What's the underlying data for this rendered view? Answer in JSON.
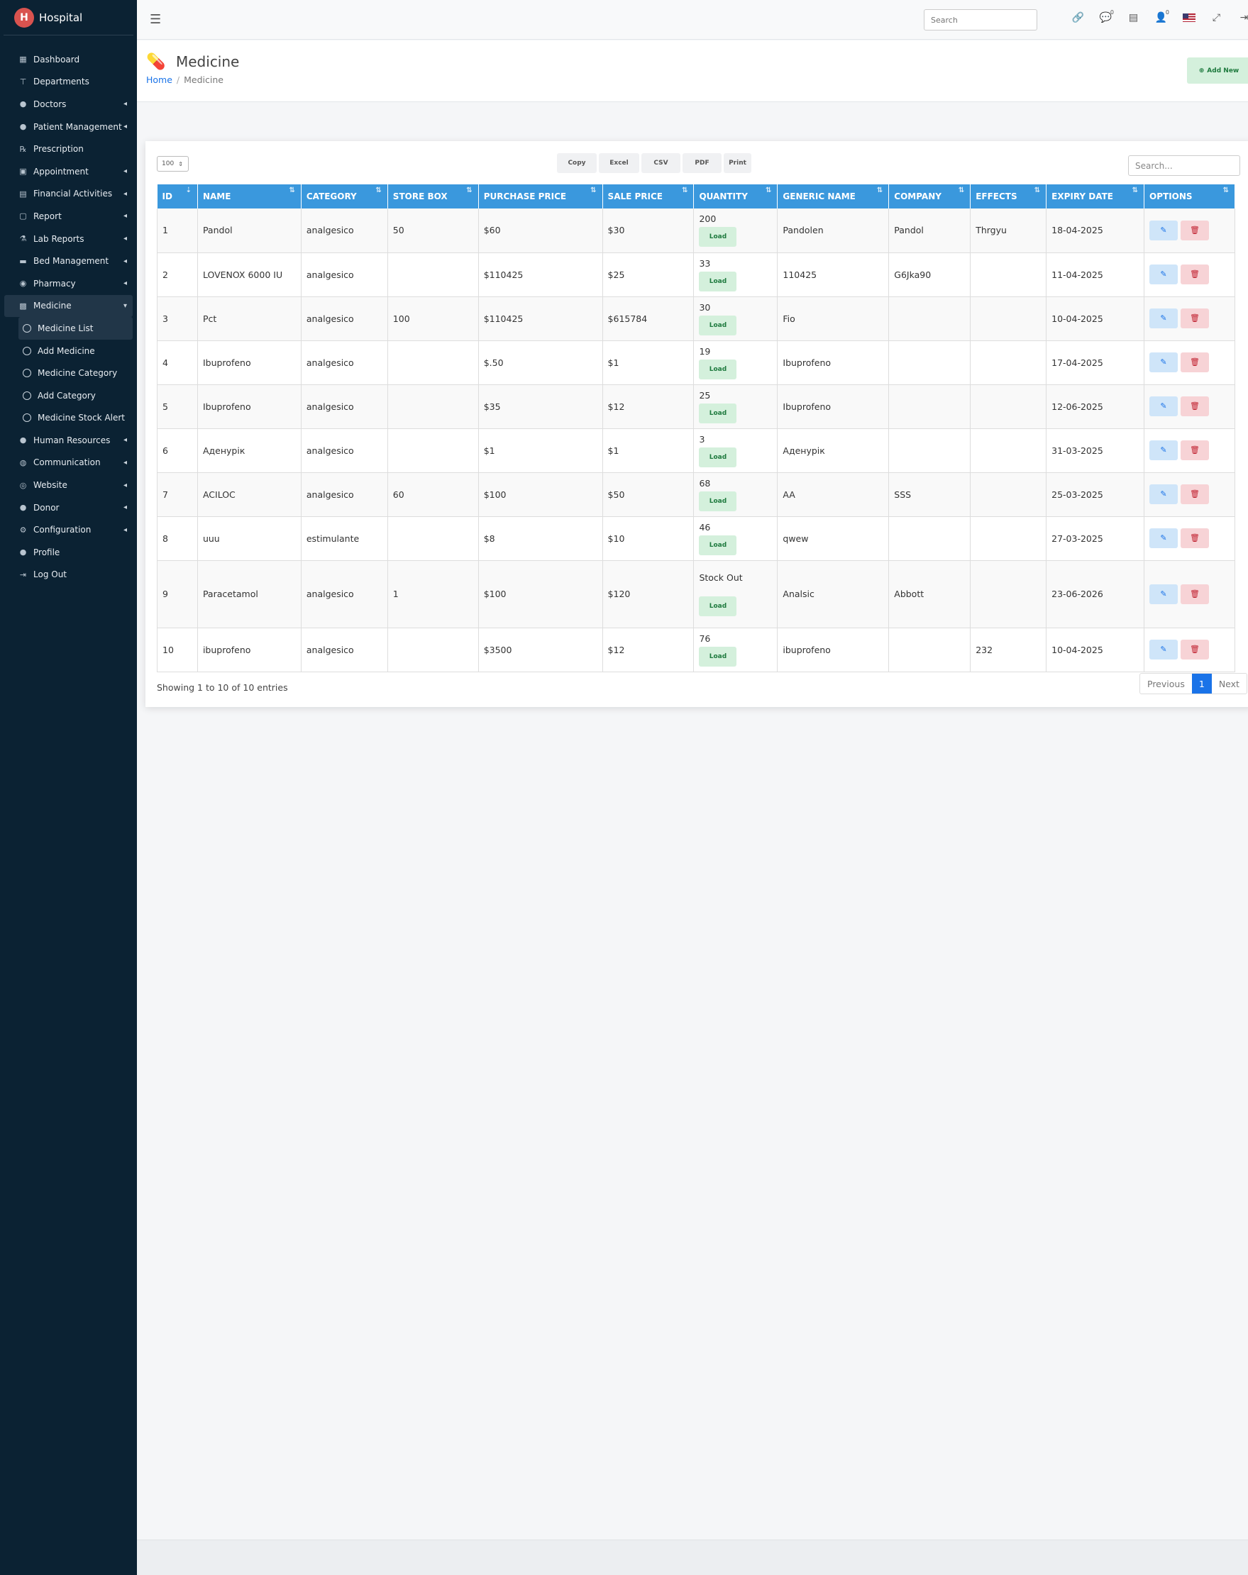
{
  "brand": {
    "name": "Hospital",
    "logo_letter": "H"
  },
  "sidebar": {
    "items": [
      {
        "label": "Dashboard",
        "icon": "grid-icon",
        "glyph": "▦",
        "chevron": false
      },
      {
        "label": "Departments",
        "icon": "sitemap-icon",
        "glyph": "⊤",
        "chevron": false
      },
      {
        "label": "Doctors",
        "icon": "user-md-icon",
        "glyph": "●",
        "chevron": true
      },
      {
        "label": "Patient Management",
        "icon": "user-icon",
        "glyph": "●",
        "chevron": true
      },
      {
        "label": "Prescription",
        "icon": "prescription-icon",
        "glyph": "℞",
        "chevron": false
      },
      {
        "label": "Appointment",
        "icon": "calendar-check-icon",
        "glyph": "▣",
        "chevron": true
      },
      {
        "label": "Financial Activities",
        "icon": "money-icon",
        "glyph": "▤",
        "chevron": true
      },
      {
        "label": "Report",
        "icon": "file-icon",
        "glyph": "▢",
        "chevron": true
      },
      {
        "label": "Lab Reports",
        "icon": "flask-icon",
        "glyph": "⚗",
        "chevron": true
      },
      {
        "label": "Bed Management",
        "icon": "bed-icon",
        "glyph": "▬",
        "chevron": true
      },
      {
        "label": "Pharmacy",
        "icon": "pills-icon",
        "glyph": "◉",
        "chevron": true
      },
      {
        "label": "Medicine",
        "icon": "medkit-icon",
        "glyph": "▩",
        "chevron": true,
        "active": true
      }
    ],
    "sub_items": [
      {
        "label": "Medicine List",
        "active": true
      },
      {
        "label": "Add Medicine"
      },
      {
        "label": "Medicine Category"
      },
      {
        "label": "Add Category"
      },
      {
        "label": "Medicine Stock Alert"
      }
    ],
    "items_after": [
      {
        "label": "Human Resources",
        "icon": "users-icon",
        "glyph": "●",
        "chevron": true
      },
      {
        "label": "Communication",
        "icon": "comments-icon",
        "glyph": "◍",
        "chevron": true
      },
      {
        "label": "Website",
        "icon": "globe-icon",
        "glyph": "◎",
        "chevron": true
      },
      {
        "label": "Donor",
        "icon": "user-hand-icon",
        "glyph": "●",
        "chevron": true
      },
      {
        "label": "Configuration",
        "icon": "gear-icon",
        "glyph": "⚙",
        "chevron": true
      },
      {
        "label": "Profile",
        "icon": "user-icon",
        "glyph": "●",
        "chevron": false
      },
      {
        "label": "Log Out",
        "icon": "logout-icon",
        "glyph": "⇥",
        "chevron": false
      }
    ]
  },
  "topbar": {
    "search_placeholder": "Search",
    "icons": [
      "link-icon",
      "chat-icon",
      "id-card-icon",
      "user-icon",
      "us-flag-icon",
      "fullscreen-icon",
      "signout-icon"
    ],
    "chat_badge": "0",
    "user_badge": "0"
  },
  "page": {
    "title": "Medicine",
    "breadcrumb_home": "Home",
    "breadcrumb_current": "Medicine",
    "add_new_label": "Add New"
  },
  "table_controls": {
    "page_length": "100",
    "export_buttons": [
      "Copy",
      "Excel",
      "CSV",
      "PDF",
      "Print"
    ],
    "search_placeholder": "Search..."
  },
  "table": {
    "columns": [
      "ID",
      "NAME",
      "CATEGORY",
      "STORE BOX",
      "PURCHASE PRICE",
      "SALE PRICE",
      "QUANTITY",
      "GENERIC NAME",
      "COMPANY",
      "EFFECTS",
      "EXPIRY DATE",
      "OPTIONS"
    ],
    "load_label": "Load",
    "rows": [
      {
        "id": "1",
        "name": "Pandol",
        "category": "analgesico",
        "store_box": "50",
        "purchase": "$60",
        "sale": "$30",
        "qty": "200",
        "generic": "Pandolen",
        "company": "Pandol",
        "effects": "Thrgyu",
        "expiry": "18-04-2025"
      },
      {
        "id": "2",
        "name": "LOVENOX 6000 IU",
        "category": "analgesico",
        "store_box": "",
        "purchase": "$110425",
        "sale": "$25",
        "qty": "33",
        "generic": "110425",
        "company": "G6Jka90",
        "effects": "",
        "expiry": "11-04-2025"
      },
      {
        "id": "3",
        "name": "Pct",
        "category": "analgesico",
        "store_box": "100",
        "purchase": "$110425",
        "sale": "$615784",
        "qty": "30",
        "generic": "Fio",
        "company": "",
        "effects": "",
        "expiry": "10-04-2025"
      },
      {
        "id": "4",
        "name": "Ibuprofeno",
        "category": "analgesico",
        "store_box": "",
        "purchase": "$.50",
        "sale": "$1",
        "qty": "19",
        "generic": "Ibuprofeno",
        "company": "",
        "effects": "",
        "expiry": "17-04-2025"
      },
      {
        "id": "5",
        "name": "Ibuprofeno",
        "category": "analgesico",
        "store_box": "",
        "purchase": "$35",
        "sale": "$12",
        "qty": "25",
        "generic": "Ibuprofeno",
        "company": "",
        "effects": "",
        "expiry": "12-06-2025"
      },
      {
        "id": "6",
        "name": "Аденурік",
        "category": "analgesico",
        "store_box": "",
        "purchase": "$1",
        "sale": "$1",
        "qty": "3",
        "generic": "Аденурік",
        "company": "",
        "effects": "",
        "expiry": "31-03-2025"
      },
      {
        "id": "7",
        "name": "ACILOC",
        "category": "analgesico",
        "store_box": "60",
        "purchase": "$100",
        "sale": "$50",
        "qty": "68",
        "generic": "AA",
        "company": "SSS",
        "effects": "",
        "expiry": "25-03-2025"
      },
      {
        "id": "8",
        "name": "uuu",
        "category": "estimulante",
        "store_box": "",
        "purchase": "$8",
        "sale": "$10",
        "qty": "46",
        "generic": "qwew",
        "company": "",
        "effects": "",
        "expiry": "27-03-2025"
      },
      {
        "id": "9",
        "name": "Paracetamol",
        "category": "analgesico",
        "store_box": "1",
        "purchase": "$100",
        "sale": "$120",
        "qty": "Stock Out",
        "generic": "Analsic",
        "company": "Abbott",
        "effects": "",
        "expiry": "23-06-2026"
      },
      {
        "id": "10",
        "name": "ibuprofeno",
        "category": "analgesico",
        "store_box": "",
        "purchase": "$3500",
        "sale": "$12",
        "qty": "76",
        "generic": "ibuprofeno",
        "company": "",
        "effects": "232",
        "expiry": "10-04-2025"
      }
    ]
  },
  "footer_info": {
    "showing": "Showing 1 to 10 of 10 entries",
    "prev": "Previous",
    "current": "1",
    "next": "Next"
  }
}
